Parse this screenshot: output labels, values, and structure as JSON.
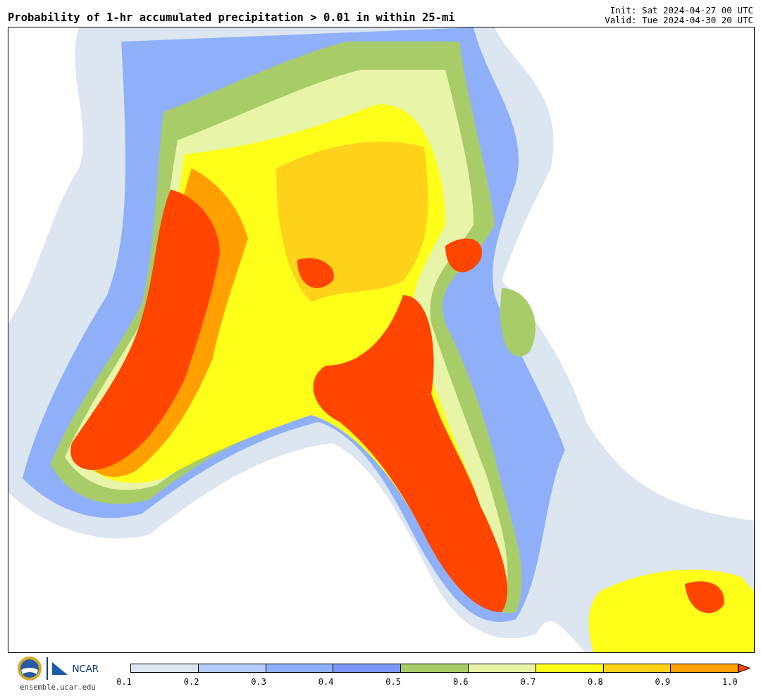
{
  "header": {
    "title": "Probability of 1-hr accumulated precipitation > 0.01 in within 25-mi",
    "init": "Init: Sat 2024-04-27 00 UTC",
    "valid": "Valid: Tue 2024-04-30 20 UTC"
  },
  "footer": {
    "logo_text": "NCAR",
    "site": "ensemble.ucar.edu"
  },
  "colorbar": {
    "segments": [
      {
        "color": "#dce6f0"
      },
      {
        "color": "#b6ccfa"
      },
      {
        "color": "#8fb0f9"
      },
      {
        "color": "#7b96f6"
      },
      {
        "color": "#a8cc68"
      },
      {
        "color": "#e8f5a8"
      },
      {
        "color": "#ffff1a"
      },
      {
        "color": "#ffd21a"
      },
      {
        "color": "#ffa000"
      }
    ],
    "ticks": [
      "0.1",
      "0.2",
      "0.3",
      "0.4",
      "0.5",
      "0.6",
      "0.7",
      "0.8",
      "0.9",
      "1.0"
    ]
  }
}
